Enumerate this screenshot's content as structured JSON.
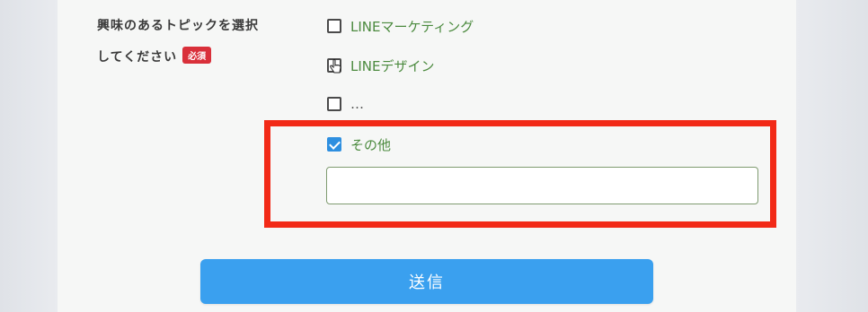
{
  "form": {
    "topic_label_line1": "興味のあるトピックを選択",
    "topic_label_line2": "してください",
    "required_badge": "必須",
    "options": [
      {
        "label": "LINEマーケティング",
        "checked": false
      },
      {
        "label": "LINEデザイン",
        "checked": false
      },
      {
        "label": "…",
        "checked": false
      },
      {
        "label": "その他",
        "checked": true
      }
    ],
    "other_input_value": "",
    "submit_label": "送信"
  },
  "colors": {
    "highlight": "#f22a17",
    "submit": "#3aa0ef",
    "badge": "#d9303a",
    "checkbox_checked": "#2e8fe0",
    "option_text": "#4b8a3e"
  }
}
